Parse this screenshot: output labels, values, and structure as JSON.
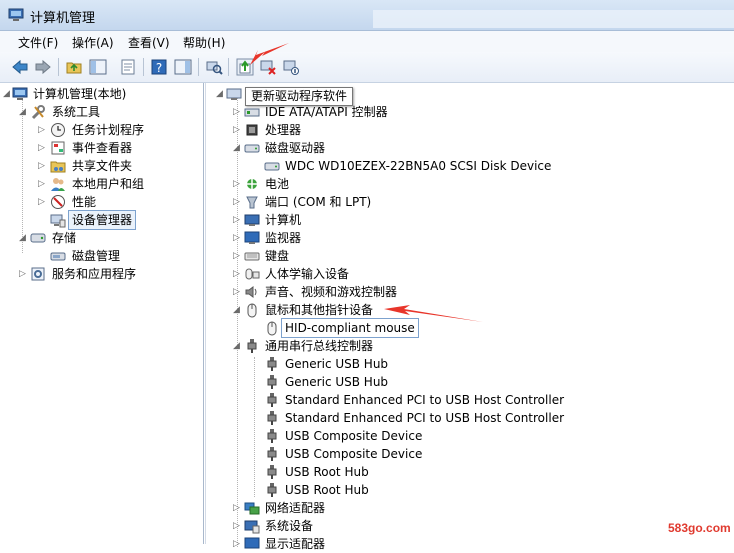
{
  "window": {
    "title": "计算机管理"
  },
  "menu": [
    "文件(F)",
    "操作(A)",
    "查看(V)",
    "帮助(H)"
  ],
  "toolbar": {
    "tooltip": "更新驱动程序软件"
  },
  "left_tree": {
    "root": "计算机管理(本地)",
    "system_tools": "系统工具",
    "system_children": [
      "任务计划程序",
      "事件查看器",
      "共享文件夹",
      "本地用户和组",
      "性能",
      "设备管理器"
    ],
    "storage": "存储",
    "storage_children": [
      "磁盘管理"
    ],
    "services": "服务和应用程序"
  },
  "device_tree": {
    "ide": "IDE ATA/ATAPI 控制器",
    "processor": "处理器",
    "disk_drives": "磁盘驱动器",
    "disk_device": "WDC WD10EZEX-22BN5A0 SCSI Disk Device",
    "battery": "电池",
    "ports": "端口 (COM 和 LPT)",
    "computer": "计算机",
    "monitors": "监视器",
    "keyboards": "键盘",
    "hid": "人体学输入设备",
    "sound": "声音、视频和游戏控制器",
    "mice": "鼠标和其他指针设备",
    "mouse_device": "HID-compliant mouse",
    "usb": "通用串行总线控制器",
    "usb_devices": [
      "Generic USB Hub",
      "Generic USB Hub",
      "Standard Enhanced PCI to USB Host Controller",
      "Standard Enhanced PCI to USB Host Controller",
      "USB Composite Device",
      "USB Composite Device",
      "USB Root Hub",
      "USB Root Hub"
    ],
    "network": "网络适配器",
    "system_devices": "系统设备",
    "display": "显示适配器"
  },
  "watermark": "583go.com",
  "colors": {
    "annotation_arrow": "#e8352a",
    "selection_border": "#7da2ce"
  }
}
